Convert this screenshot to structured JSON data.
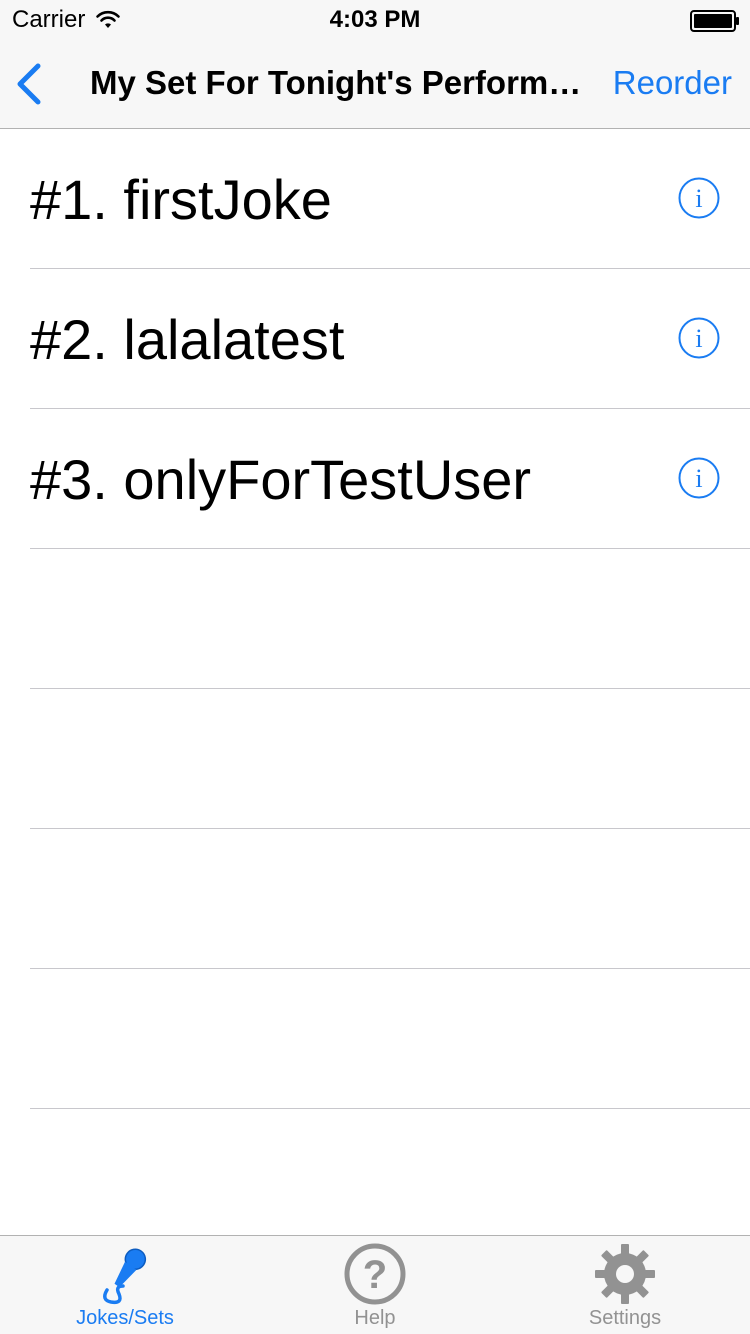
{
  "status_bar": {
    "carrier": "Carrier",
    "time": "4:03 PM"
  },
  "nav": {
    "title": "My Set For Tonight's Perform…",
    "right_button": "Reorder",
    "back_icon": "chevron-left-icon"
  },
  "list": {
    "items": [
      {
        "label": "#1. firstJoke"
      },
      {
        "label": "#2. lalalatest"
      },
      {
        "label": "#3. onlyForTestUser"
      }
    ]
  },
  "tab_bar": {
    "tabs": [
      {
        "label": "Jokes/Sets",
        "icon": "microphone-icon",
        "active": true
      },
      {
        "label": "Help",
        "icon": "help-icon",
        "active": false
      },
      {
        "label": "Settings",
        "icon": "gear-icon",
        "active": false
      }
    ]
  },
  "colors": {
    "accent": "#1a7cf2",
    "inactive": "#929292",
    "bar_background": "#f7f7f7",
    "separator": "#c8c7cc"
  }
}
